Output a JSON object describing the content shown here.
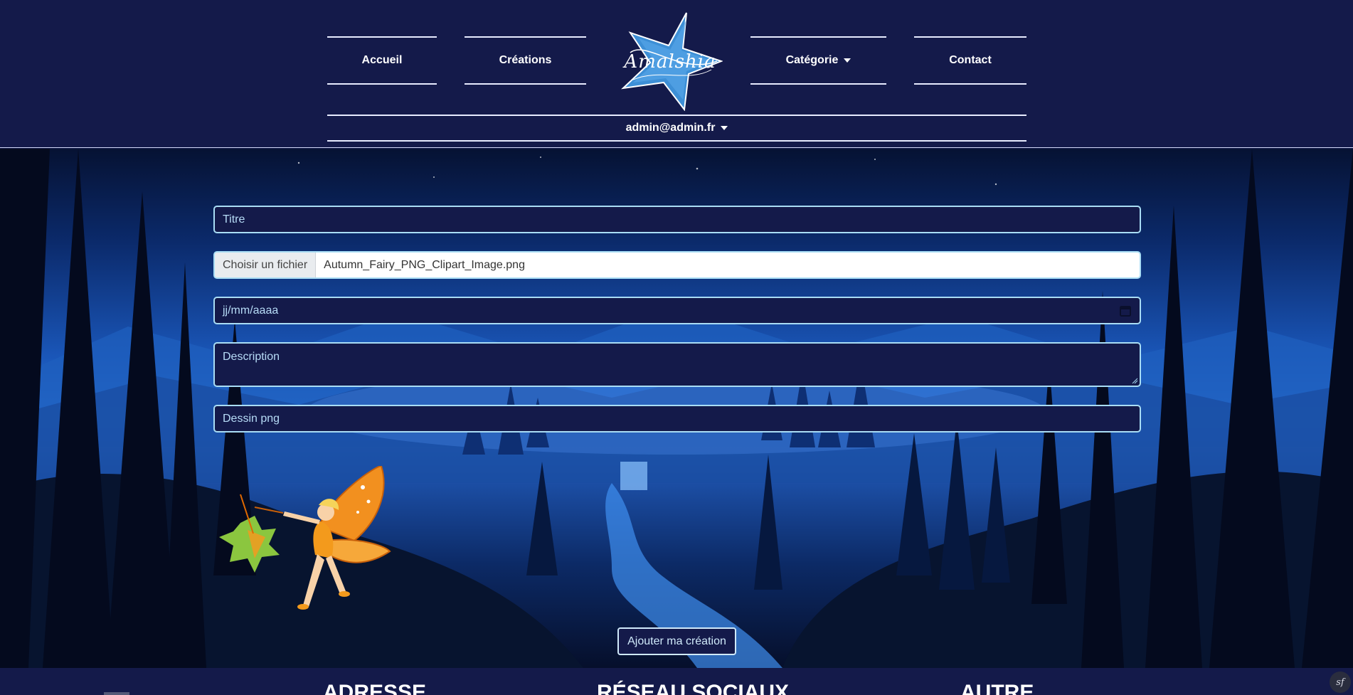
{
  "nav": {
    "accueil": "Accueil",
    "creations": "Créations",
    "categorie": "Catégorie",
    "contact": "Contact",
    "user": "admin@admin.fr"
  },
  "logo": {
    "text": "Amalshia"
  },
  "form": {
    "titre_placeholder": "Titre",
    "file_button": "Choisir un fichier",
    "file_name": "Autumn_Fairy_PNG_Clipart_Image.png",
    "date_placeholder": "jj/mm/aaaa",
    "description_placeholder": "Description",
    "dessin_placeholder": "Dessin png",
    "submit": "Ajouter ma création"
  },
  "footer": {
    "col1": "ADRESSE",
    "col2": "RÉSEAU SOCIAUX",
    "col3": "AUTRE"
  },
  "debug": {
    "badge": "sf"
  },
  "colors": {
    "navy": "#141a4a",
    "field_border": "#a9ddf5",
    "field_text": "#b7dcf7",
    "logo_star": "#3d8fd6"
  },
  "icons": [
    "caret-down-icon",
    "star-logo-icon",
    "calendar-icon",
    "resize-handle-icon",
    "symfony-icon"
  ]
}
